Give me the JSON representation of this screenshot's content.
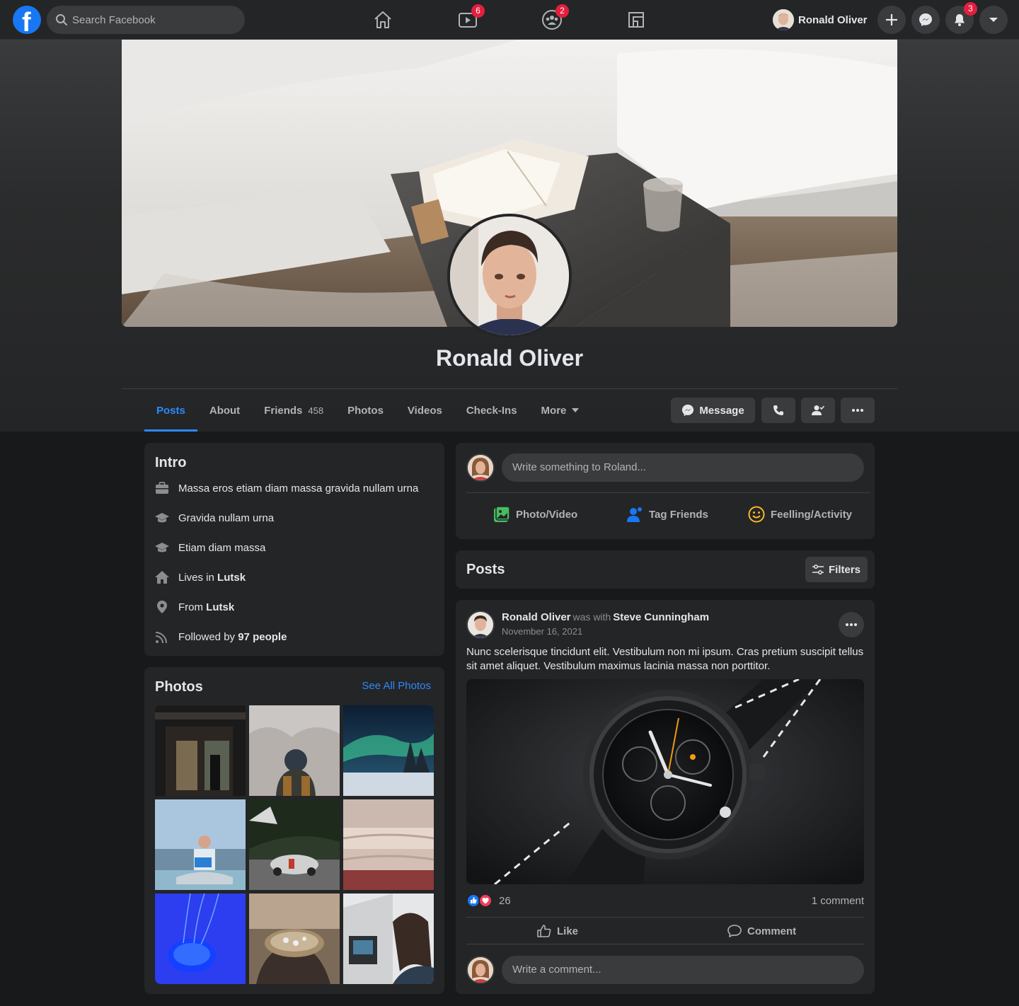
{
  "topnav": {
    "search_placeholder": "Search Facebook",
    "logo_letter": "f",
    "watch_badge": "6",
    "groups_badge": "2",
    "notifications_badge": "3",
    "user_name": "Ronald Oliver",
    "icons": [
      "home-icon",
      "watch-icon",
      "groups-icon",
      "gaming-icon",
      "plus-icon",
      "messenger-icon",
      "bell-icon",
      "caret-down-icon"
    ]
  },
  "profile": {
    "name": "Ronald Oliver",
    "tabs": [
      {
        "label": "Posts",
        "active": true
      },
      {
        "label": "About"
      },
      {
        "label": "Friends",
        "count": "458"
      },
      {
        "label": "Photos"
      },
      {
        "label": "Videos"
      },
      {
        "label": "Check-Ins"
      },
      {
        "label": "More"
      }
    ],
    "message_label": "Message"
  },
  "intro": {
    "title": "Intro",
    "items": [
      {
        "icon": "briefcase-icon",
        "text": "Massa eros etiam diam massa gravida nullam urna"
      },
      {
        "icon": "graduation-cap-icon",
        "text": "Gravida nullam urna"
      },
      {
        "icon": "graduation-cap-icon",
        "text": "Etiam diam massa"
      },
      {
        "icon": "house-icon",
        "prefix": "Lives in",
        "bold": "Lutsk"
      },
      {
        "icon": "location-pin-icon",
        "prefix": "From",
        "bold": "Lutsk"
      },
      {
        "icon": "rss-icon",
        "prefix": "Followed by",
        "bold": "97 people"
      }
    ]
  },
  "photos": {
    "title": "Photos",
    "see_all": "See All Photos"
  },
  "composer": {
    "placeholder": "Write something to Roland...",
    "photo_video": "Photo/Video",
    "tag_friends": "Tag Friends",
    "feeling": "Feelling/Activity"
  },
  "posts_header": {
    "title": "Posts",
    "filters": "Filters"
  },
  "post": {
    "author": "Ronald Oliver",
    "was_with": "was with",
    "with_name": "Steve Cunningham",
    "date": "November 16, 2021",
    "text": "Nunc scelerisque tincidunt elit. Vestibulum non mi ipsum. Cras pretium suscipit tellus sit amet aliquet. Vestibulum maximus lacinia massa non porttitor.",
    "reactions_count": "26",
    "comments_count": "1 comment",
    "like_label": "Like",
    "comment_label": "Comment",
    "comment_placeholder": "Write a comment..."
  },
  "colors": {
    "accent": "#2d88ff",
    "badge": "#e41e3f",
    "card": "#242526",
    "background": "#18191a"
  }
}
